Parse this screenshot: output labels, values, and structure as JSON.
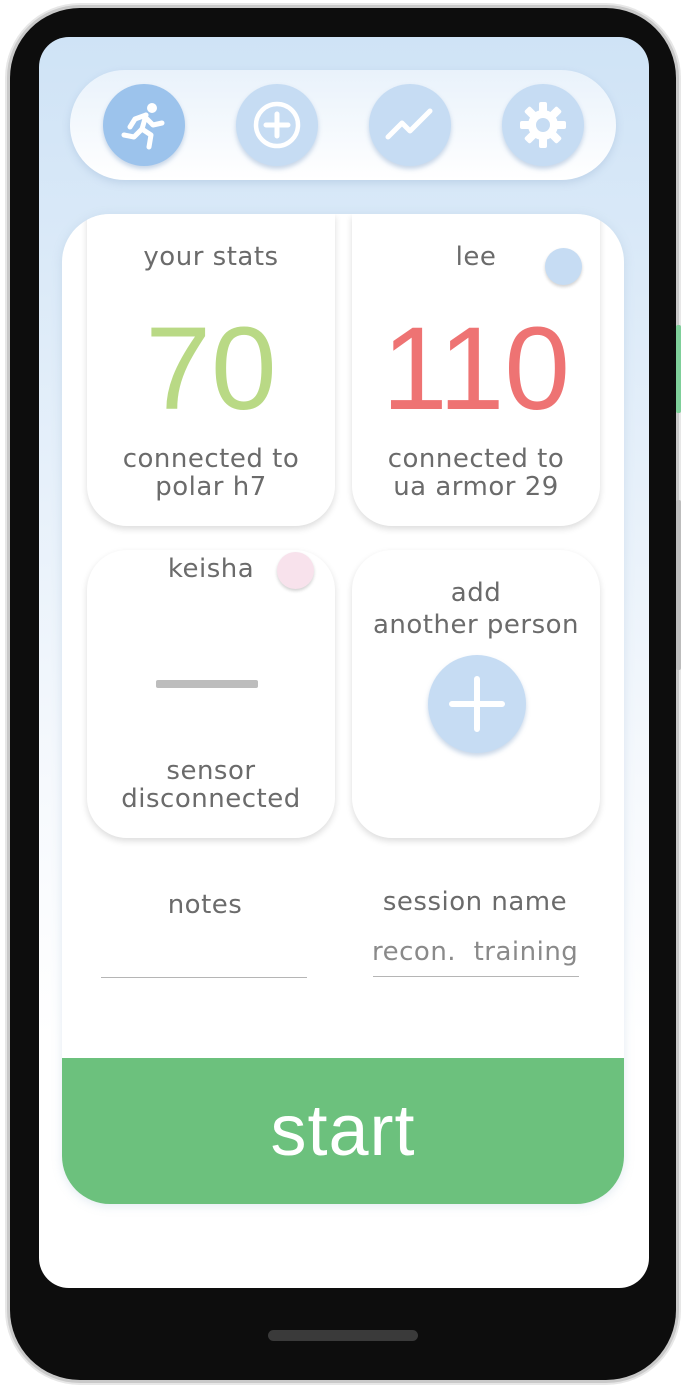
{
  "nav": {
    "items": [
      {
        "icon": "running-person-icon",
        "active": true
      },
      {
        "icon": "plus-circle-icon",
        "active": false
      },
      {
        "icon": "trend-line-icon",
        "active": false
      },
      {
        "icon": "gear-icon",
        "active": false
      }
    ]
  },
  "people": [
    {
      "name": "your stats",
      "bpm": "70",
      "bpm_color": "#b9d985",
      "status": "connected to\npolar h7",
      "dot": null
    },
    {
      "name": "lee",
      "bpm": "110",
      "bpm_color": "#ee7373",
      "status": "connected to\nua armor 29",
      "dot": "#c6dcf3"
    },
    {
      "name": "keisha",
      "bpm": null,
      "status": "sensor\ndisconnected",
      "dot": "#f8e2ec"
    }
  ],
  "add_person": {
    "label": "add\nanother person",
    "icon": "plus-icon"
  },
  "form": {
    "notes_label": "notes",
    "notes_value": "",
    "session_label": "session name",
    "session_value": "recon.  training"
  },
  "start_label": "start",
  "colors": {
    "accent_green": "#6cc17d",
    "nav_blue": "#c6dcf3",
    "nav_active": "#9cc3ec"
  }
}
